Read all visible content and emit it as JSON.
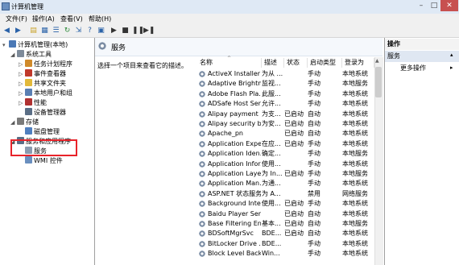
{
  "window": {
    "title": "计算机管理"
  },
  "menu": [
    "文件(F)",
    "操作(A)",
    "查看(V)",
    "帮助(H)"
  ],
  "tree": [
    {
      "label": "计算机管理(本地)",
      "indent": 0,
      "icon": "computer-icon",
      "arrow": "▾"
    },
    {
      "label": "系统工具",
      "indent": 1,
      "icon": "tools-icon",
      "arrow": "◢"
    },
    {
      "label": "任务计划程序",
      "indent": 2,
      "icon": "clock-icon",
      "arrow": "▷"
    },
    {
      "label": "事件查看器",
      "indent": 2,
      "icon": "event-icon",
      "arrow": "▷"
    },
    {
      "label": "共享文件夹",
      "indent": 2,
      "icon": "folder-icon",
      "arrow": "▷"
    },
    {
      "label": "本地用户和组",
      "indent": 2,
      "icon": "users-icon",
      "arrow": "▷"
    },
    {
      "label": "性能",
      "indent": 2,
      "icon": "performance-icon",
      "arrow": "▷"
    },
    {
      "label": "设备管理器",
      "indent": 2,
      "icon": "device-icon",
      "arrow": ""
    },
    {
      "label": "存储",
      "indent": 1,
      "icon": "storage-icon",
      "arrow": "◢"
    },
    {
      "label": "磁盘管理",
      "indent": 2,
      "icon": "disk-icon",
      "arrow": ""
    },
    {
      "label": "服务和应用程序",
      "indent": 1,
      "icon": "apps-icon",
      "arrow": "◢"
    },
    {
      "label": "服务",
      "indent": 2,
      "icon": "services-icon",
      "arrow": ""
    },
    {
      "label": "WMI 控件",
      "indent": 2,
      "icon": "wmi-icon",
      "arrow": ""
    }
  ],
  "services_header": {
    "title": "服务",
    "description": "选择一个项目来查看它的描述。"
  },
  "table": {
    "columns": [
      "名称",
      "描述",
      "状态",
      "启动类型",
      "登录为"
    ],
    "rows": [
      [
        "ActiveX Installer ...",
        "为从 ...",
        "",
        "手动",
        "本地系统"
      ],
      [
        "Adaptive Brightne...",
        "监视...",
        "",
        "手动",
        "本地服务"
      ],
      [
        "Adobe Flash Pla...",
        "此服...",
        "",
        "手动",
        "本地系统"
      ],
      [
        "ADSafe Host Ser...",
        "允许...",
        "",
        "手动",
        "本地系统"
      ],
      [
        "Alipay payment ...",
        "为支...",
        "已启动",
        "自动",
        "本地系统"
      ],
      [
        "Alipay security b...",
        "为安...",
        "已启动",
        "自动",
        "本地系统"
      ],
      [
        "Apache_pn",
        "",
        "已启动",
        "自动",
        "本地系统"
      ],
      [
        "Application Expe...",
        "在应...",
        "已启动",
        "手动",
        "本地系统"
      ],
      [
        "Application Iden...",
        "确定...",
        "",
        "手动",
        "本地服务"
      ],
      [
        "Application Infor...",
        "使用...",
        "",
        "手动",
        "本地系统"
      ],
      [
        "Application Laye...",
        "为 In...",
        "已启动",
        "手动",
        "本地服务"
      ],
      [
        "Application Man...",
        "为通...",
        "",
        "手动",
        "本地系统"
      ],
      [
        "ASP.NET 状态服务",
        "为 A...",
        "",
        "禁用",
        "网络服务"
      ],
      [
        "Background Inte...",
        "使用...",
        "已启动",
        "手动",
        "本地系统"
      ],
      [
        "Baidu Player Ser...",
        "",
        "已启动",
        "自动",
        "本地系统"
      ],
      [
        "Base Filtering En...",
        "基本...",
        "已启动",
        "自动",
        "本地服务"
      ],
      [
        "BDSoftMgrSvc",
        "BDE...",
        "已启动",
        "自动",
        "本地系统"
      ],
      [
        "BitLocker Drive ...",
        "BDE...",
        "",
        "手动",
        "本地系统"
      ],
      [
        "Block Level Back...",
        "Win...",
        "",
        "手动",
        "本地系统"
      ]
    ]
  },
  "actions": {
    "title": "操作",
    "section": "服务",
    "more": "更多操作"
  }
}
